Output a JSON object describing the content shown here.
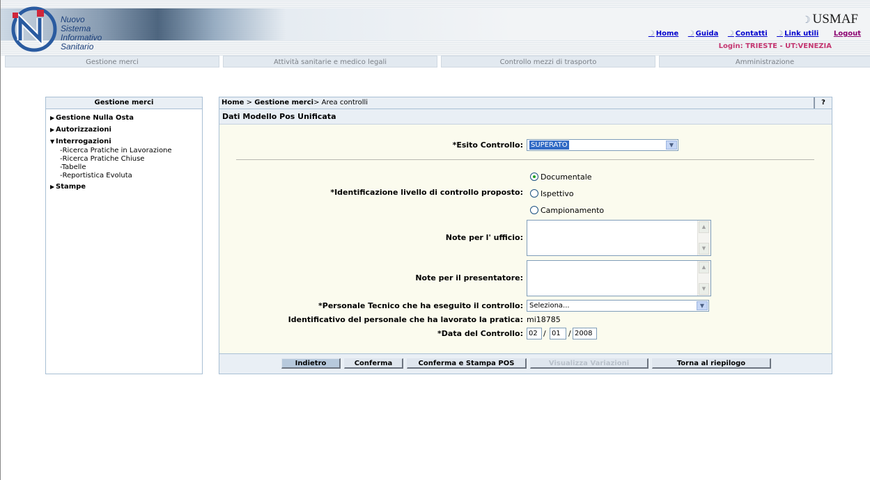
{
  "header": {
    "logo_lines": [
      "Nuovo",
      "Sistema",
      "Informativo",
      "Sanitario"
    ],
    "app_name": "USMAF",
    "links": [
      "Home",
      "Guida",
      "Contatti",
      "Link utili"
    ],
    "logout": "Logout",
    "login": "Login: TRIESTE - UT:VENEZIA"
  },
  "nav": {
    "tabs": [
      "Gestione merci",
      "Attività sanitarie e medico legali",
      "Controllo mezzi di trasporto",
      "Amministrazione"
    ]
  },
  "sidebar": {
    "title": "Gestione merci",
    "items": [
      {
        "label": "Gestione Nulla Osta",
        "expanded": false
      },
      {
        "label": "Autorizzazioni",
        "expanded": false
      },
      {
        "label": "Interrogazioni",
        "expanded": true
      },
      {
        "label": "Stampe",
        "expanded": false
      }
    ],
    "subitems": [
      "-Ricerca Pratiche in Lavorazione",
      "-Ricerca Pratiche Chiuse",
      "-Tabelle",
      "-Reportistica Evoluta"
    ]
  },
  "breadcrumb": {
    "home": "Home",
    "sep1": " > ",
    "section": "Gestione merci",
    "sep2": "> ",
    "current": "Area controlli"
  },
  "help_label": "?",
  "form": {
    "title": "Dati Modello Pos Unificata",
    "esito_label": "*Esito Controllo:",
    "esito_value": "SUPERATO",
    "livello_label": "*Identificazione livello di controllo proposto:",
    "livello_options": [
      "Documentale",
      "Ispettivo",
      "Campionamento"
    ],
    "livello_selected": "Documentale",
    "note_ufficio_label": "Note per l' ufficio:",
    "note_ufficio_value": "",
    "note_presentatore_label": "Note per il presentatore:",
    "note_presentatore_value": "",
    "personale_label": "*Personale Tecnico che ha eseguito il controllo:",
    "personale_value": "Seleziona...",
    "identificativo_label": "Identificativo del personale che ha lavorato la pratica:",
    "identificativo_value": "mi18785",
    "data_label": "*Data del Controllo:",
    "data_day": "02",
    "data_month": "01",
    "data_year": "2008",
    "date_sep": "/"
  },
  "buttons": {
    "indietro": "Indietro",
    "conferma": "Conferma",
    "conferma_stampa": "Conferma e Stampa POS",
    "visualizza": "Visualizza Variazioni",
    "torna": "Torna al riepilogo"
  },
  "icons": {
    "dropdown": "chevron-down-icon",
    "expand": "triangle-right-icon",
    "collapse": "triangle-down-icon"
  }
}
